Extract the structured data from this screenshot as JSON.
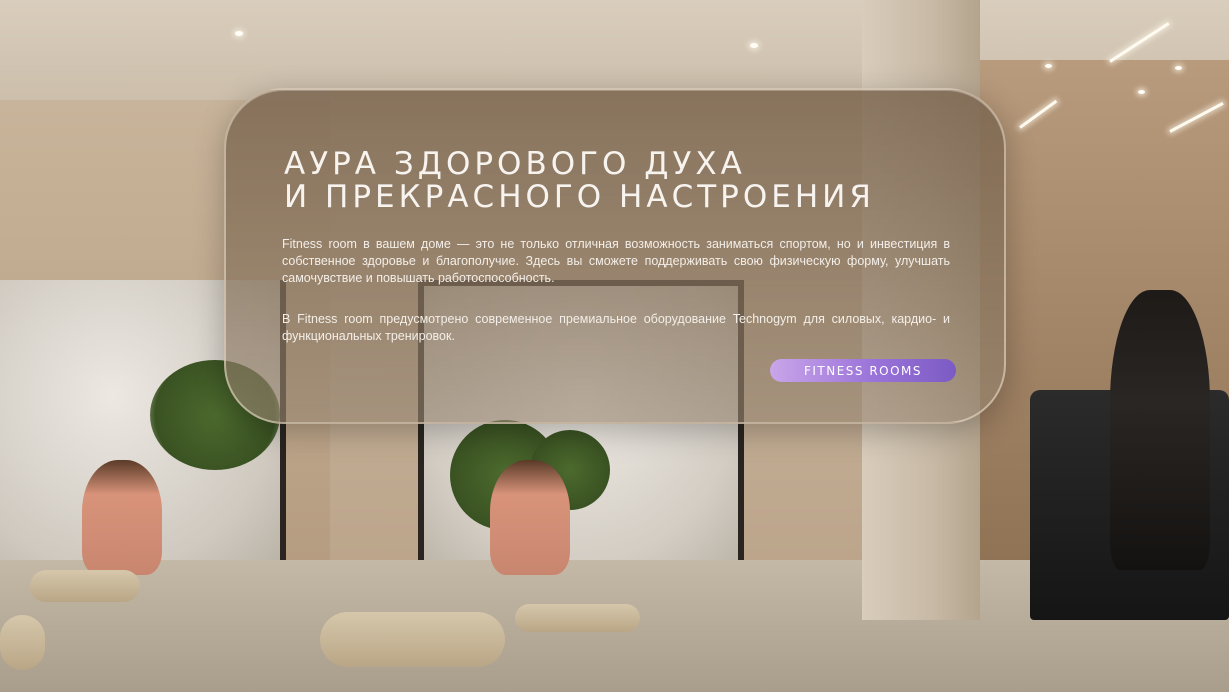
{
  "card": {
    "title_line1": "АУРА ЗДОРОВОГО ДУХА",
    "title_line2": "И ПРЕКРАСНОГО НАСТРОЕНИЯ",
    "paragraph1": "Fitness room в вашем доме — это не только отличная возможность заниматься спортом, но и инвестиция в собственное здоровье и благополучие. Здесь вы сможете поддерживать свою физическую форму, улучшать самочувствие и повышать работоспособность.",
    "paragraph2": "В Fitness room предусмотрено современное премиальное оборудование Technogym для силовых, кардио- и функциональных тренировок.",
    "button_label": "FITNESS ROOMS"
  },
  "colors": {
    "button_gradient_start": "#c9a5e9",
    "button_gradient_end": "#7b5bc4",
    "card_text": "#f7f3ee"
  }
}
